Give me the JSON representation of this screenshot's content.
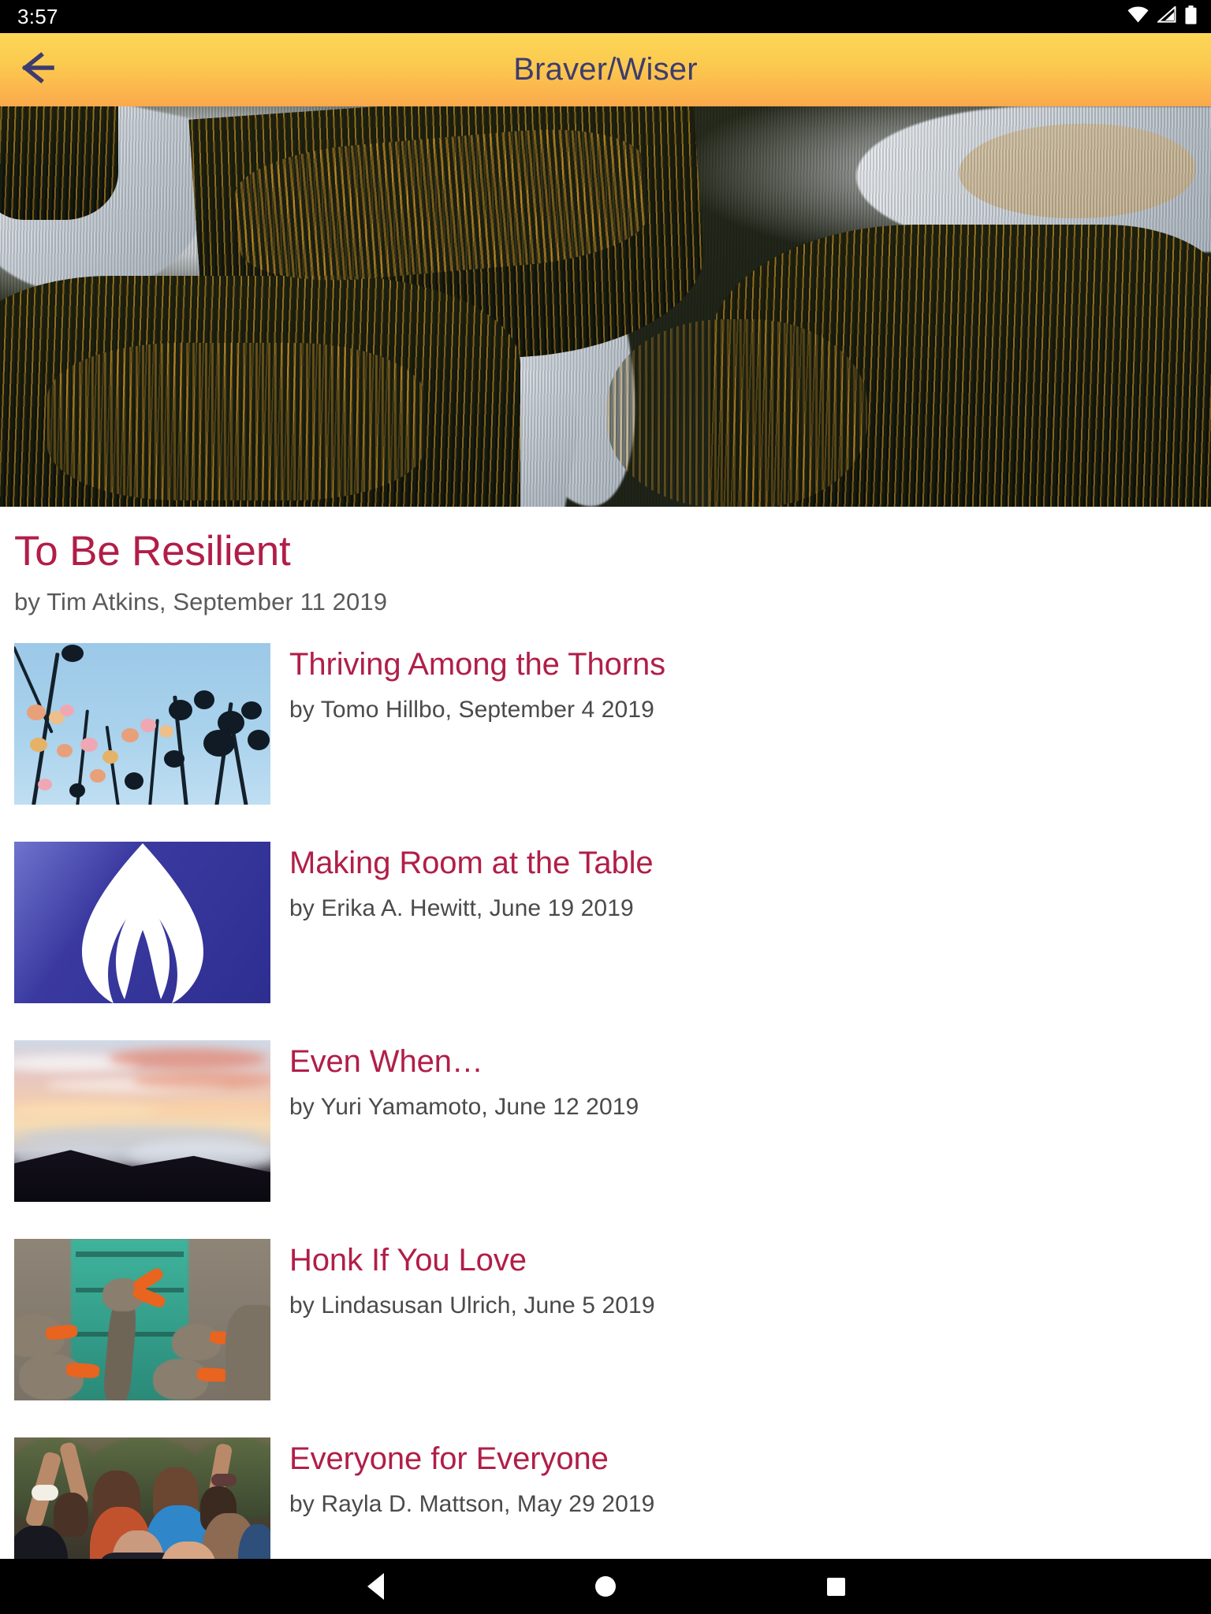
{
  "status_bar": {
    "time": "3:57",
    "icons": [
      "wifi-icon",
      "cellular-signal-icon",
      "battery-icon"
    ]
  },
  "app_bar": {
    "title": "Braver/Wiser",
    "back_icon": "arrow-left-icon",
    "gradient_top": "#FCD757",
    "gradient_bottom": "#FBA94B",
    "title_color": "#3E3C6E"
  },
  "theme": {
    "title_color": "#B11E48",
    "byline_color": "#4A4A4A",
    "background": "#FFFFFF"
  },
  "hero": {
    "alt": "Aerial view of a winding river through autumn boreal forest"
  },
  "featured": {
    "title": "To Be Resilient",
    "byline": "by Tim Atkins, September 11 2019"
  },
  "list": {
    "items": [
      {
        "title": "Thriving Among the Thorns",
        "byline": "by Tomo Hillbo, September 4 2019",
        "thumb": "thistle-flowers-blue-sky"
      },
      {
        "title": "Making Room at the Table",
        "byline": "by Erika A. Hewitt, June 19 2019",
        "thumb": "flaming-chalice-logo"
      },
      {
        "title": "Even When…",
        "byline": "by Yuri Yamamoto, June 12 2019",
        "thumb": "sunset-above-clouds"
      },
      {
        "title": "Honk If You Love",
        "byline": "by Lindasusan Ulrich, June 5 2019",
        "thumb": "geese-teal-door"
      },
      {
        "title": "Everyone for Everyone",
        "byline": "by Rayla D. Mattson, May 29 2019",
        "thumb": "cheering-crowd"
      }
    ]
  },
  "nav_bar": {
    "back_label": "Back",
    "home_label": "Home",
    "recents_label": "Recents"
  }
}
